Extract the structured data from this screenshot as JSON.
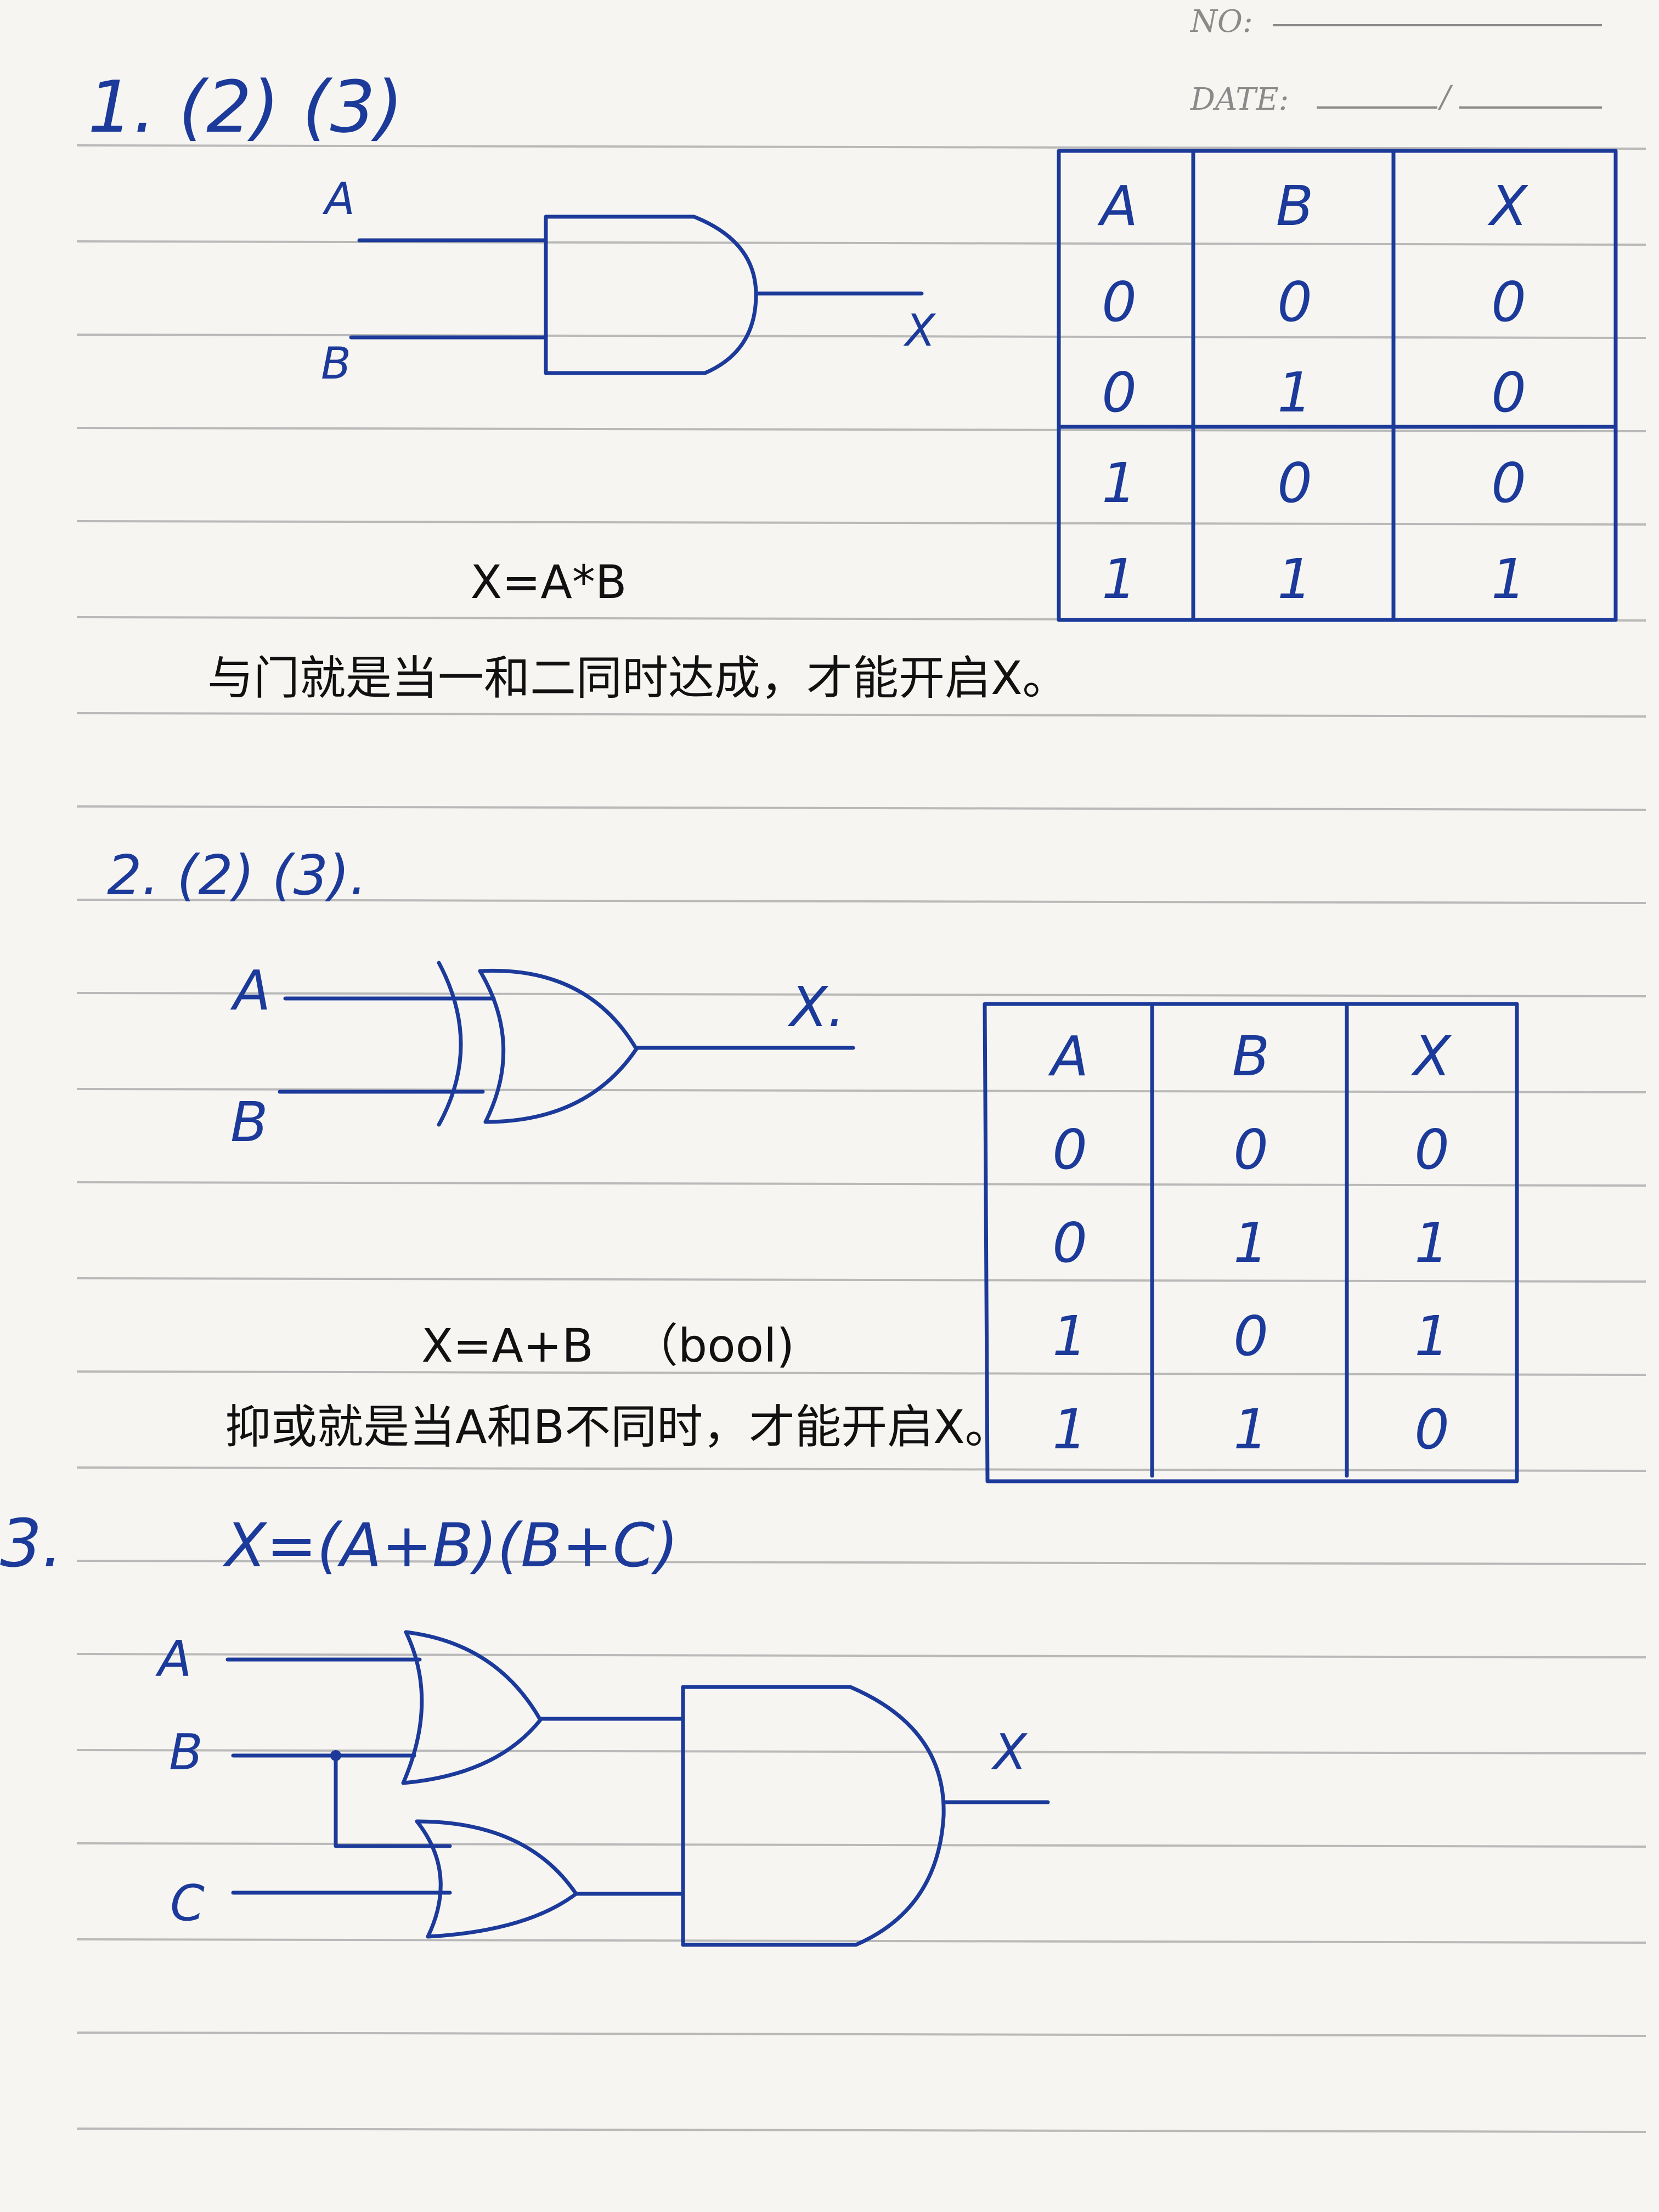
{
  "header": {
    "no_label": "NO:",
    "date_label": "DATE:",
    "date_sep": "/"
  },
  "q1": {
    "title": "1. (2) (3)",
    "inputs": [
      "A",
      "B"
    ],
    "output": "X",
    "table_headers": [
      "A",
      "B",
      "X"
    ],
    "table_rows": [
      [
        "0",
        "0",
        "0"
      ],
      [
        "0",
        "1",
        "0"
      ],
      [
        "1",
        "0",
        "0"
      ],
      [
        "1",
        "1",
        "1"
      ]
    ],
    "formula": "X=A*B",
    "explanation": "与门就是当一和二同时达成，才能开启X。"
  },
  "q2": {
    "title": "2. (2) (3).",
    "inputs": [
      "A",
      "B"
    ],
    "output": "X.",
    "table_headers": [
      "A",
      "B",
      "X"
    ],
    "table_rows": [
      [
        "0",
        "0",
        "0"
      ],
      [
        "0",
        "1",
        "1"
      ],
      [
        "1",
        "0",
        "1"
      ],
      [
        "1",
        "1",
        "0"
      ]
    ],
    "formula": "X=A+B",
    "formula_note": "（bool)",
    "explanation": "抑或就是当A和B不同时，才能开启X。"
  },
  "q3": {
    "title": "3.",
    "formula": "X=(A+B)(B+C)",
    "inputs": [
      "A",
      "B",
      "C"
    ],
    "output": "X"
  },
  "colors": {
    "ink": "#1c3a9a",
    "paper": "#f6f5f1",
    "rule": "#b9b9b9",
    "print": "#111111"
  }
}
